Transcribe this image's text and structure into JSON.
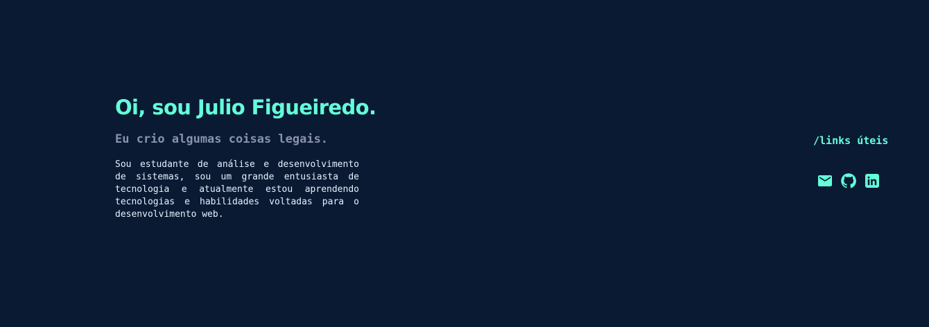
{
  "hero": {
    "title": "Oi, sou Julio Figueiredo.",
    "subtitle": "Eu crio algumas coisas legais.",
    "about": "Sou estudante de análise e desenvolvimento de sistemas, sou um grande entusiasta de tecnologia e atualmente estou aprendendo tecnologias e habilidades voltadas para o desenvolvimento web."
  },
  "links": {
    "title": "/links úteis",
    "icons": [
      "mail-icon",
      "github-icon",
      "linkedin-icon"
    ]
  },
  "colors": {
    "background": "#0a1a33",
    "accent": "#64ffda",
    "muted": "#8892b0",
    "text": "#e6f1ff"
  }
}
